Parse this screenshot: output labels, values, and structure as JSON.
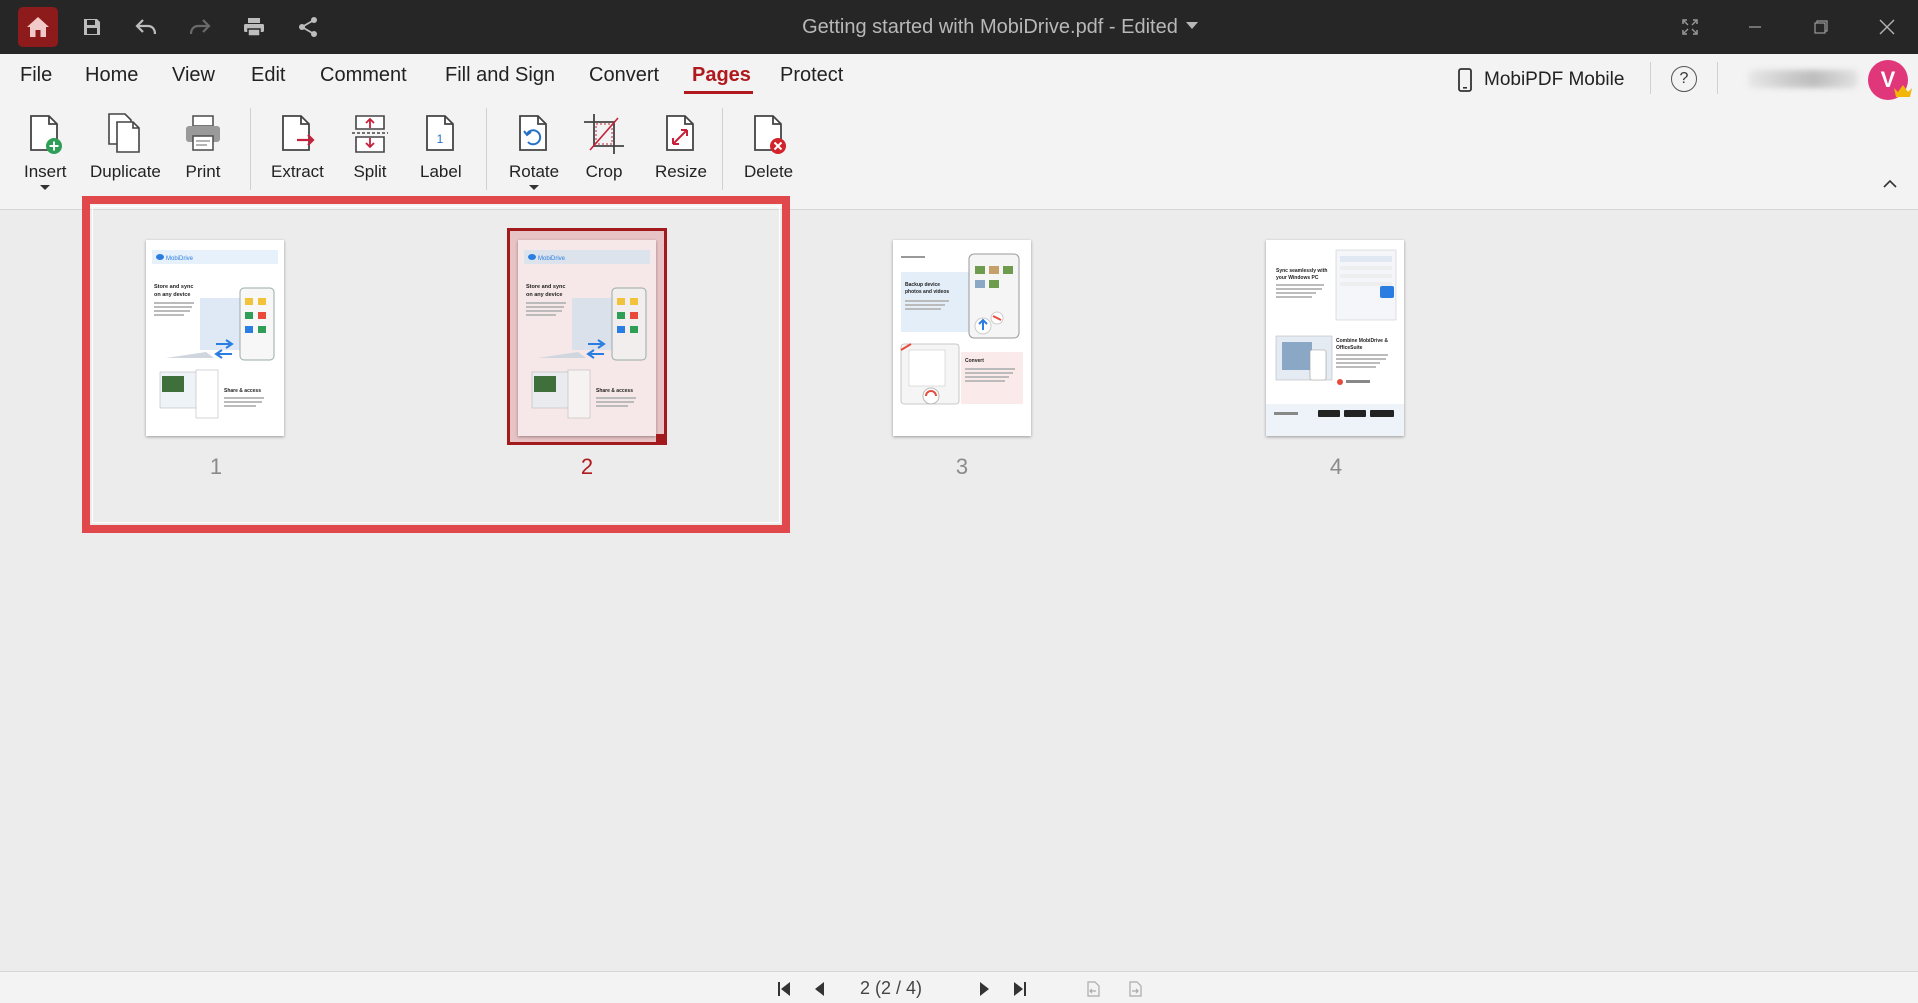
{
  "window": {
    "title": "Getting started with MobiDrive.pdf - Edited"
  },
  "menu": {
    "items": [
      "File",
      "Home",
      "View",
      "Edit",
      "Comment",
      "Fill and Sign",
      "Convert",
      "Pages",
      "Protect"
    ],
    "active": "Pages",
    "mobile_label": "MobiPDF Mobile",
    "help_label": "?",
    "avatar_letter": "V"
  },
  "toolbar": {
    "insert": "Insert",
    "duplicate": "Duplicate",
    "print": "Print",
    "extract": "Extract",
    "split": "Split",
    "label": "Label",
    "label_glyph": "1",
    "rotate": "Rotate",
    "crop": "Crop",
    "resize": "Resize",
    "delete": "Delete"
  },
  "pages": [
    {
      "number": "1",
      "heading": "Store and sync on any device",
      "brand": "MobiDrive",
      "section": "Share & access"
    },
    {
      "number": "2",
      "heading": "Store and sync on any device",
      "brand": "MobiDrive",
      "section": "Share & access"
    },
    {
      "number": "3",
      "heading": "Backup device photos and videos",
      "brand": "",
      "section": "Convert"
    },
    {
      "number": "4",
      "heading": "Sync seamlessly with your Windows PC",
      "brand": "",
      "section": "Combine MobiDrive & OfficeSuite"
    }
  ],
  "selected_page": "2",
  "status": {
    "page_indicator": "2 (2 / 4)"
  },
  "colors": {
    "accent": "#b0191d",
    "titlebar": "#262626",
    "selection": "#e0484c",
    "avatar": "#e0367a"
  }
}
